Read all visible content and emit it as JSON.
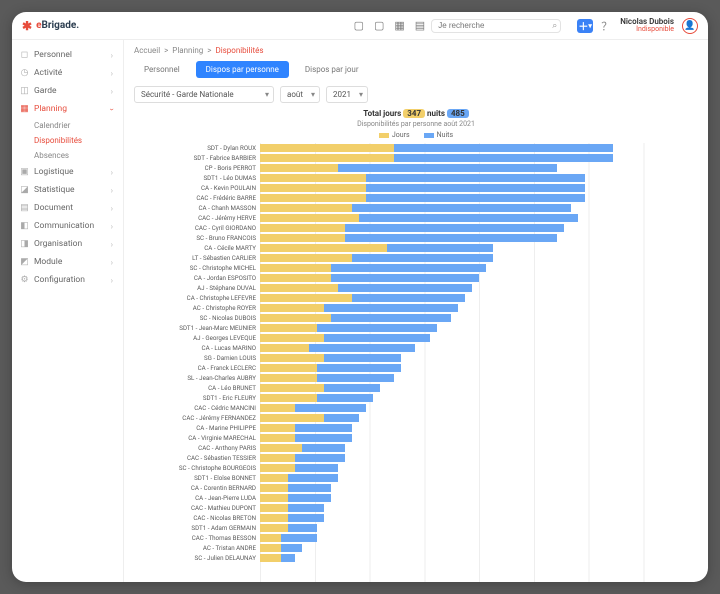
{
  "brand": {
    "pre": "e",
    "post": "Brigade."
  },
  "search": {
    "placeholder": "Je recherche"
  },
  "user": {
    "name": "Nicolas Dubois",
    "status": "Indisponible"
  },
  "nav": {
    "items": [
      {
        "icon": "◻",
        "label": "Personnel",
        "active": false
      },
      {
        "icon": "◷",
        "label": "Activité",
        "active": false
      },
      {
        "icon": "◫",
        "label": "Garde",
        "active": false
      },
      {
        "icon": "▦",
        "label": "Planning",
        "active": true,
        "sub": [
          {
            "label": "Calendrier",
            "sel": false
          },
          {
            "label": "Disponibilités",
            "sel": true
          },
          {
            "label": "Absences",
            "sel": false
          }
        ]
      },
      {
        "icon": "▣",
        "label": "Logistique",
        "active": false
      },
      {
        "icon": "◪",
        "label": "Statistique",
        "active": false
      },
      {
        "icon": "▤",
        "label": "Document",
        "active": false
      },
      {
        "icon": "◧",
        "label": "Communication",
        "active": false
      },
      {
        "icon": "◨",
        "label": "Organisation",
        "active": false
      },
      {
        "icon": "◩",
        "label": "Module",
        "active": false
      },
      {
        "icon": "⚙",
        "label": "Configuration",
        "active": false
      }
    ]
  },
  "breadcrumb": {
    "a": "Accueil",
    "b": "Planning",
    "c": "Disponibilités"
  },
  "tabs": [
    {
      "label": "Personnel",
      "active": false
    },
    {
      "label": "Dispos par personne",
      "active": true
    },
    {
      "label": "Dispos par jour",
      "active": false
    }
  ],
  "filters": {
    "equipe": "Sécurité - Garde Nationale",
    "mois": "août",
    "annee": "2021"
  },
  "chart_header": {
    "prefix": "Total jours ",
    "days": "347",
    "mid": " nuits ",
    "nights": "485"
  },
  "chart_sub": "Disponibilités par personne août 2021",
  "legend": {
    "jours": "Jours",
    "nuits": "Nuits"
  },
  "chart_data": {
    "type": "bar",
    "series_names": [
      "Jours",
      "Nuits"
    ],
    "xlabel": "",
    "ylabel": "",
    "max": 62,
    "rows": [
      {
        "name": "SDT - Dylan ROUX",
        "j": 19,
        "n": 31
      },
      {
        "name": "SDT - Fabrice BARBIER",
        "j": 19,
        "n": 31
      },
      {
        "name": "CP - Boris PERROT",
        "j": 11,
        "n": 31
      },
      {
        "name": "SDT1 - Léo DUMAS",
        "j": 15,
        "n": 31
      },
      {
        "name": "CA - Kevin POULAIN",
        "j": 15,
        "n": 31
      },
      {
        "name": "CAC - Frédéric BARRE",
        "j": 15,
        "n": 31
      },
      {
        "name": "CA - Chanh MASSON",
        "j": 13,
        "n": 31
      },
      {
        "name": "CAC - Jérémy HERVE",
        "j": 14,
        "n": 31
      },
      {
        "name": "CAC - Cyril GIORDANO",
        "j": 12,
        "n": 31
      },
      {
        "name": "SC - Bruno FRANCOIS",
        "j": 12,
        "n": 30
      },
      {
        "name": "CA - Cécile MARTY",
        "j": 18,
        "n": 15
      },
      {
        "name": "LT - Sébastien CARLIER",
        "j": 13,
        "n": 20
      },
      {
        "name": "SC - Christophe MICHEL",
        "j": 10,
        "n": 22
      },
      {
        "name": "CA - Jordan ESPOSITO",
        "j": 10,
        "n": 21
      },
      {
        "name": "AJ - Stéphane DUVAL",
        "j": 11,
        "n": 19
      },
      {
        "name": "CA - Christophe LEFEVRE",
        "j": 13,
        "n": 16
      },
      {
        "name": "AC - Christophe ROYER",
        "j": 9,
        "n": 19
      },
      {
        "name": "SC - Nicolas DUBOIS",
        "j": 10,
        "n": 17
      },
      {
        "name": "SDT1 - Jean-Marc MEUNIER",
        "j": 8,
        "n": 17
      },
      {
        "name": "AJ - Georges LEVEQUE",
        "j": 9,
        "n": 15
      },
      {
        "name": "CA - Lucas MARINO",
        "j": 7,
        "n": 15
      },
      {
        "name": "SG - Damien LOUIS",
        "j": 9,
        "n": 11
      },
      {
        "name": "CA - Franck LECLERC",
        "j": 8,
        "n": 12
      },
      {
        "name": "SL - Jean-Charles AUBRY",
        "j": 8,
        "n": 11
      },
      {
        "name": "CA - Léo BRUNET",
        "j": 9,
        "n": 8
      },
      {
        "name": "SDT1 - Eric FLEURY",
        "j": 8,
        "n": 8
      },
      {
        "name": "CAC - Cédric MANCINI",
        "j": 5,
        "n": 10
      },
      {
        "name": "CAC - Jérémy FERNANDEZ",
        "j": 9,
        "n": 5
      },
      {
        "name": "CA - Marine PHILIPPE",
        "j": 5,
        "n": 8
      },
      {
        "name": "CA - Virginie MARECHAL",
        "j": 5,
        "n": 8
      },
      {
        "name": "CAC - Anthony PARIS",
        "j": 6,
        "n": 6
      },
      {
        "name": "CAC - Sébastien TESSIER",
        "j": 5,
        "n": 7
      },
      {
        "name": "SC - Christophe BOURGEOIS",
        "j": 5,
        "n": 6
      },
      {
        "name": "SDT1 - Eloïse BONNET",
        "j": 4,
        "n": 7
      },
      {
        "name": "CA - Corentin BERNARD",
        "j": 4,
        "n": 6
      },
      {
        "name": "CA - Jean-Pierre LUDA",
        "j": 4,
        "n": 6
      },
      {
        "name": "CAC - Mathieu DUPONT",
        "j": 4,
        "n": 5
      },
      {
        "name": "CAC - Nicolas BRETON",
        "j": 4,
        "n": 5
      },
      {
        "name": "SDT1 - Adam GERMAIN",
        "j": 4,
        "n": 4
      },
      {
        "name": "CAC - Thomas BESSON",
        "j": 3,
        "n": 5
      },
      {
        "name": "AC - Tristan ANDRE",
        "j": 3,
        "n": 3
      },
      {
        "name": "SC - Julien DELAUNAY",
        "j": 3,
        "n": 2
      }
    ]
  }
}
